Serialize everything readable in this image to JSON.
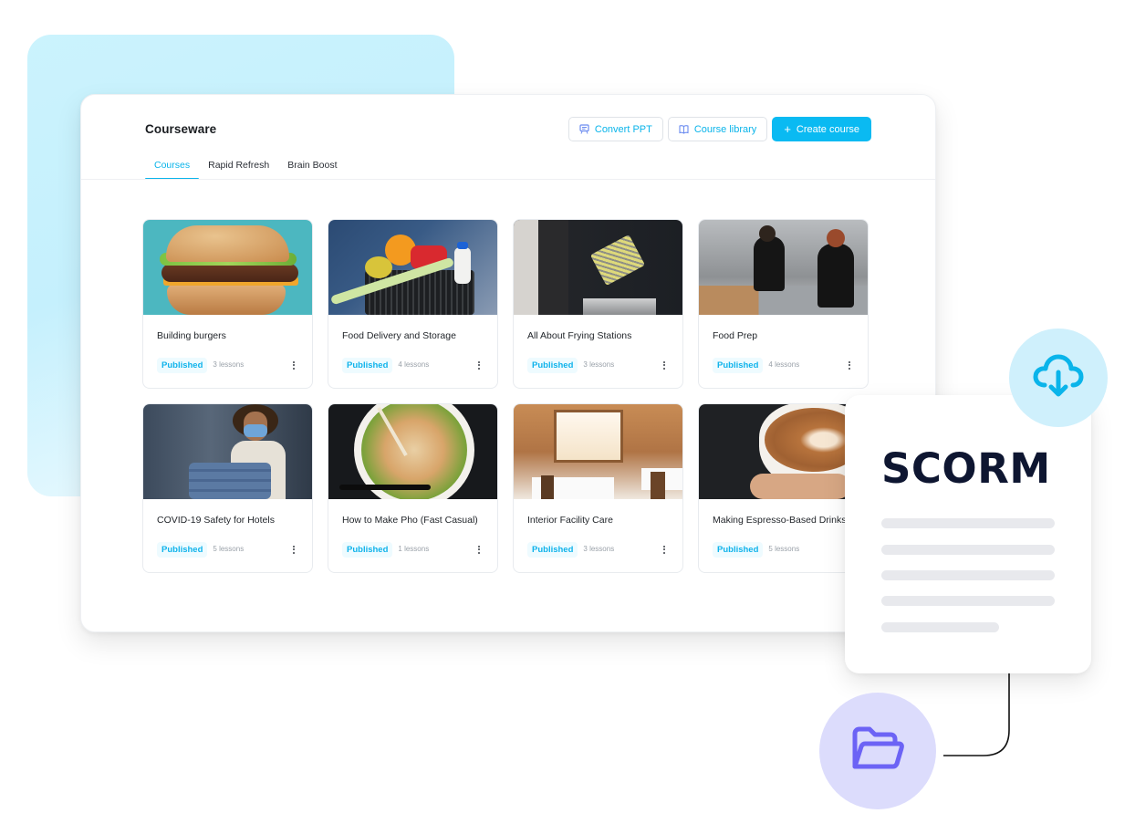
{
  "app": {
    "title": "Courseware"
  },
  "header": {
    "actions": [
      {
        "label": "Convert PPT",
        "icon": "presentation-icon",
        "style": "outline"
      },
      {
        "label": "Course library",
        "icon": "book-icon",
        "style": "outline"
      },
      {
        "label": "Create course",
        "icon": "plus-icon",
        "style": "primary"
      }
    ]
  },
  "tabs": [
    {
      "label": "Courses",
      "active": true
    },
    {
      "label": "Rapid Refresh",
      "active": false
    },
    {
      "label": "Brain Boost",
      "active": false
    }
  ],
  "courses": [
    {
      "title": "Building burgers",
      "status": "Published",
      "lessons": "3 lessons",
      "image": "burger"
    },
    {
      "title": "Food Delivery and Storage",
      "status": "Published",
      "lessons": "4 lessons",
      "image": "grocery-basket"
    },
    {
      "title": "All About Frying Stations",
      "status": "Published",
      "lessons": "3 lessons",
      "image": "fryer"
    },
    {
      "title": "Food Prep",
      "status": "Published",
      "lessons": "4 lessons",
      "image": "kitchen-prep"
    },
    {
      "title": "COVID-19 Safety for Hotels",
      "status": "Published",
      "lessons": "5 lessons",
      "image": "housekeeper-mask"
    },
    {
      "title": "How to Make Pho (Fast Casual)",
      "status": "Published",
      "lessons": "1 lessons",
      "image": "pho-bowl"
    },
    {
      "title": "Interior Facility Care",
      "status": "Published",
      "lessons": "3 lessons",
      "image": "restaurant-interior"
    },
    {
      "title": "Making Espresso-Based Drinks",
      "status": "Published",
      "lessons": "5 lessons",
      "image": "latte-art"
    }
  ],
  "scorm": {
    "title": "SCORM",
    "download_icon": "cloud-download-icon",
    "folder_icon": "folder-open-icon"
  },
  "colors": {
    "accent": "#0abaf2",
    "badge_bg": "#eefbff",
    "scorm_text": "#0e1631",
    "download_circle": "#cff0fc",
    "folder_circle": "#dcdcfc",
    "folder_icon": "#6c63f5",
    "backdrop": "#c5f0fd"
  }
}
